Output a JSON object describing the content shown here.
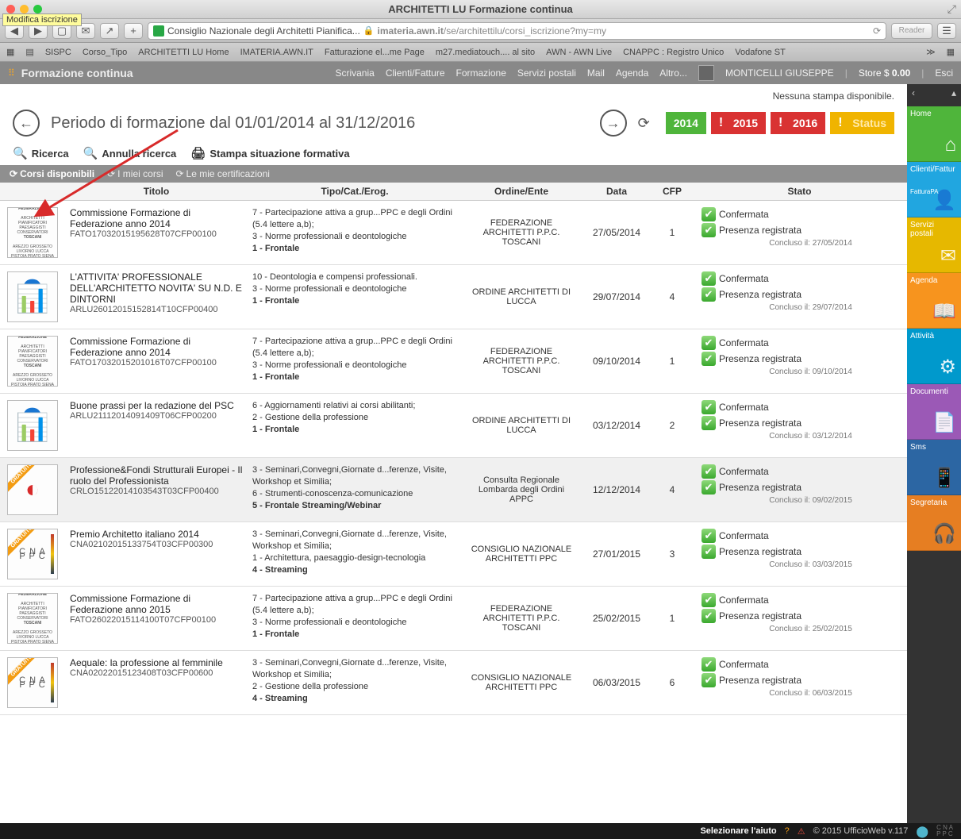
{
  "mac": {
    "title": "ARCHITETTI LU Formazione continua",
    "tooltip": "Modifica iscrizione"
  },
  "addr": {
    "tab_title": "Consiglio Nazionale degli Architetti Pianifica...",
    "url_host": "imateria.awn.it",
    "url_path": "/se/architettilu/corsi_iscrizione?my=my",
    "reader": "Reader"
  },
  "bookmarks": [
    "SISPC",
    "Corso_Tipo",
    "ARCHITETTI LU Home",
    "IMATERIA.AWN.IT",
    "Fatturazione el...me Page",
    "m27.mediatouch.... al sito",
    "AWN - AWN Live",
    "CNAPPC : Registro Unico",
    "Vodafone ST"
  ],
  "appbar": {
    "brand": "Formazione continua",
    "menu": [
      "Scrivania",
      "Clienti/Fatture",
      "Formazione",
      "Servizi postali",
      "Mail",
      "Agenda",
      "Altro..."
    ],
    "user": "MONTICELLI GIUSEPPE",
    "store_label": "Store $",
    "store_val": "0.00",
    "esc": "Esci"
  },
  "rnav": [
    {
      "label": "Home",
      "cls": "t-home",
      "ic": "⌂"
    },
    {
      "label": "Clienti/Fattur",
      "sub": "FatturaPA",
      "cls": "t-clienti",
      "ic": "👤"
    },
    {
      "label": "Servizi postali",
      "cls": "t-servizi",
      "ic": "✉"
    },
    {
      "label": "Agenda",
      "cls": "t-agenda",
      "ic": "📖"
    },
    {
      "label": "Attività",
      "cls": "t-attivita",
      "ic": "⚙"
    },
    {
      "label": "Documenti",
      "cls": "t-doc",
      "ic": "📄"
    },
    {
      "label": "Sms",
      "cls": "t-sms",
      "ic": "📱"
    },
    {
      "label": "Segretaria",
      "cls": "t-seg",
      "ic": "🎧"
    }
  ],
  "content": {
    "nostampa": "Nessuna stampa disponibile.",
    "period_title": "Periodo di formazione dal 01/01/2014 al 31/12/2016",
    "years": [
      {
        "label": "2014",
        "cls": "yb-2014",
        "bang": false
      },
      {
        "label": "2015",
        "cls": "yb-2015",
        "bang": true
      },
      {
        "label": "2016",
        "cls": "yb-2016",
        "bang": true
      },
      {
        "label": "Status",
        "cls": "yb-status",
        "bang": true
      }
    ],
    "actions": {
      "ricerca": "Ricerca",
      "annulla": "Annulla ricerca",
      "stampa": "Stampa situazione formativa"
    },
    "tabs": [
      "Corsi disponibili",
      "I miei corsi",
      "Le mie certificazioni"
    ],
    "headers": {
      "titolo": "Titolo",
      "tipo": "Tipo/Cat./Erog.",
      "ente": "Ordine/Ente",
      "data": "Data",
      "cfp": "CFP",
      "stato": "Stato"
    },
    "rows": [
      {
        "thumb": "fed",
        "ribbon": "",
        "titolo": "Commissione Formazione di Federazione anno 2014",
        "code": "FATO17032015195628T07CFP00100",
        "tipo": [
          "7 - Partecipazione attiva a grup...PPC e degli Ordini (5.4 lettere a,b);",
          "3 - Norme professionali e deontologiche",
          "<b>1 - Frontale</b>"
        ],
        "ente": "FEDERAZIONE ARCHITETTI P.P.C. TOSCANI",
        "data": "27/05/2014",
        "cfp": "1",
        "stato": {
          "conf": "Confermata",
          "pres": "Presenza registrata",
          "concl": "Concluso il: 27/05/2014"
        }
      },
      {
        "thumb": "pic",
        "ribbon": "",
        "titolo": "L'ATTIVITA' PROFESSIONALE DELL'ARCHITETTO NOVITA' SU N.D. E DINTORNI",
        "code": "ARLU26012015152814T10CFP00400",
        "tipo": [
          "10 - Deontologia e compensi professionali.",
          "3 - Norme professionali e deontologiche",
          "<b>1 - Frontale</b>"
        ],
        "ente": "ORDINE ARCHITETTI DI LUCCA",
        "data": "29/07/2014",
        "cfp": "4",
        "stato": {
          "conf": "Confermata",
          "pres": "Presenza registrata",
          "concl": "Concluso il: 29/07/2014"
        }
      },
      {
        "thumb": "fed",
        "ribbon": "",
        "titolo": "Commissione Formazione di Federazione anno 2014",
        "code": "FATO17032015201016T07CFP00100",
        "tipo": [
          "7 - Partecipazione attiva a grup...PPC e degli Ordini (5.4 lettere a,b);",
          "3 - Norme professionali e deontologiche",
          "<b>1 - Frontale</b>"
        ],
        "ente": "FEDERAZIONE ARCHITETTI P.P.C. TOSCANI",
        "data": "09/10/2014",
        "cfp": "1",
        "stato": {
          "conf": "Confermata",
          "pres": "Presenza registrata",
          "concl": "Concluso il: 09/10/2014"
        }
      },
      {
        "thumb": "pic",
        "ribbon": "",
        "titolo": "Buone prassi per la redazione del PSC",
        "code": "ARLU21112014091409T06CFP00200",
        "tipo": [
          "6 - Aggiornamenti relativi ai corsi abilitanti;",
          "2 - Gestione della professione",
          "<b>1 - Frontale</b>"
        ],
        "ente": "ORDINE ARCHITETTI DI LUCCA",
        "data": "03/12/2014",
        "cfp": "2",
        "stato": {
          "conf": "Confermata",
          "pres": "Presenza registrata",
          "concl": "Concluso il: 03/12/2014"
        }
      },
      {
        "thumb": "logo",
        "ribbon": "GRATUITO",
        "alt": true,
        "titolo": "Professione&Fondi Strutturali Europei - Il ruolo del Professionista",
        "code": "CRLO15122014103543T03CFP00400",
        "tipo": [
          "3 - Seminari,Convegni,Giornate d...ferenze, Visite, Workshop et Similia;",
          "6 - Strumenti-conoscenza-comunicazione",
          "<b>5 - Frontale Streaming/Webinar</b>"
        ],
        "ente": "Consulta Regionale Lombarda degli Ordini APPC",
        "data": "12/12/2014",
        "cfp": "4",
        "stato": {
          "conf": "Confermata",
          "pres": "Presenza registrata",
          "concl": "Concluso il: 09/02/2015"
        }
      },
      {
        "thumb": "cnappc",
        "ribbon": "GRATUITO",
        "titolo": "Premio Architetto italiano 2014",
        "code": "CNA02102015133754T03CFP00300",
        "tipo": [
          "3 - Seminari,Convegni,Giornate d...ferenze, Visite, Workshop et Similia;",
          "1 - Architettura, paesaggio-design-tecnologia",
          "<b>4 - Streaming</b>"
        ],
        "ente": "CONSIGLIO NAZIONALE ARCHITETTI PPC",
        "data": "27/01/2015",
        "cfp": "3",
        "stato": {
          "conf": "Confermata",
          "pres": "Presenza registrata",
          "concl": "Concluso il: 03/03/2015"
        }
      },
      {
        "thumb": "fed",
        "ribbon": "",
        "titolo": "Commissione Formazione di Federazione anno 2015",
        "code": "FATO26022015114100T07CFP00100",
        "tipo": [
          "7 - Partecipazione attiva a grup...PPC e degli Ordini (5.4 lettere a,b);",
          "3 - Norme professionali e deontologiche",
          "<b>1 - Frontale</b>"
        ],
        "ente": "FEDERAZIONE ARCHITETTI P.P.C. TOSCANI",
        "data": "25/02/2015",
        "cfp": "1",
        "stato": {
          "conf": "Confermata",
          "pres": "Presenza registrata",
          "concl": "Concluso il: 25/02/2015"
        }
      },
      {
        "thumb": "cnappc",
        "ribbon": "GRATUITO",
        "titolo": "Aequale: la professione al femminile",
        "code": "CNA02022015123408T03CFP00600",
        "tipo": [
          "3 - Seminari,Convegni,Giornate d...ferenze, Visite, Workshop et Similia;",
          "2 - Gestione della professione",
          "<b>4 - Streaming</b>"
        ],
        "ente": "CONSIGLIO NAZIONALE ARCHITETTI PPC",
        "data": "06/03/2015",
        "cfp": "6",
        "stato": {
          "conf": "Confermata",
          "pres": "Presenza registrata",
          "concl": "Concluso il: 06/03/2015"
        }
      }
    ]
  },
  "footer": {
    "sel": "Selezionare l'aiuto",
    "copy": "© 2015 UfficioWeb v.117"
  }
}
